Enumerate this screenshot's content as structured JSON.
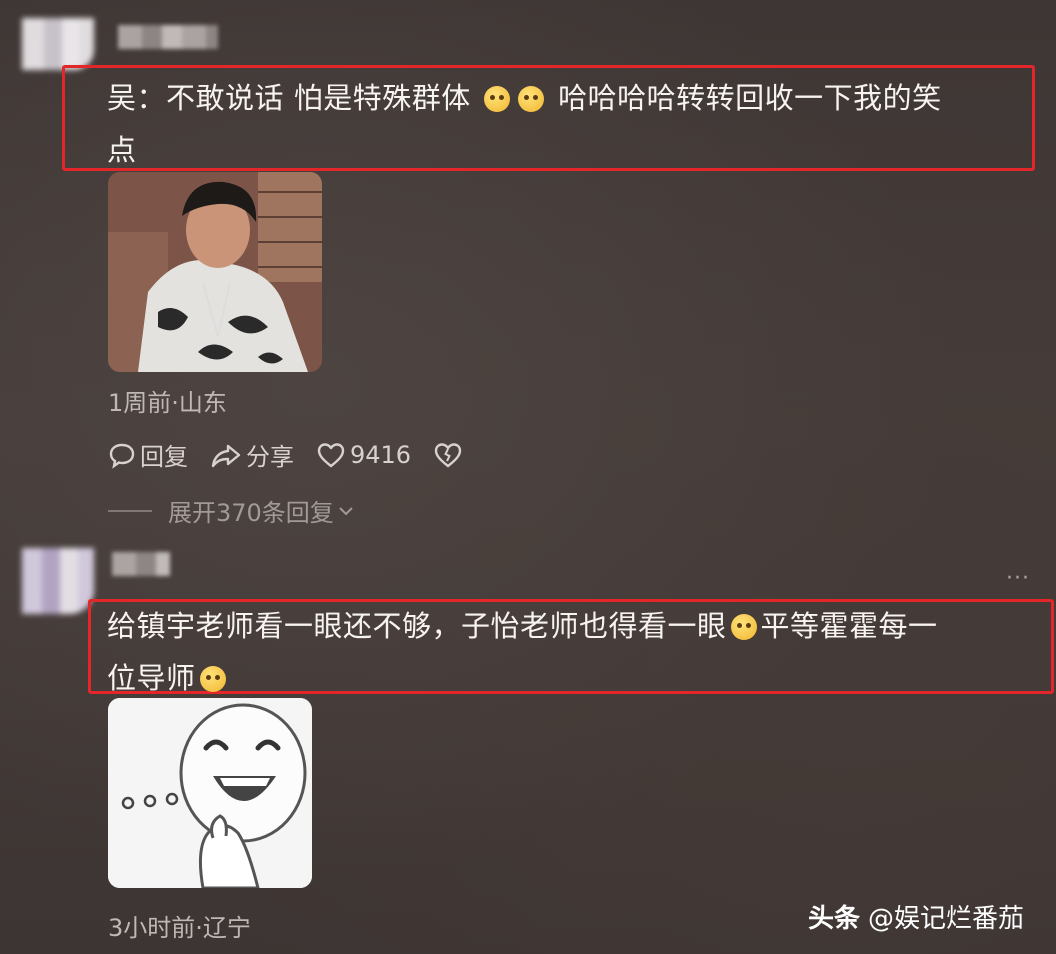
{
  "comments": [
    {
      "text_line1": "吴：不敢说话 怕是特殊群体",
      "text_line1_tail": "哈哈哈哈转转回收一下我的笑",
      "text_line2": "点",
      "meta": "1周前·山东",
      "reply_label": "回复",
      "share_label": "分享",
      "likes": "9416",
      "expand_label": "展开370条回复",
      "image_icon": "man-in-camo-jacket-photo"
    },
    {
      "text_line1": "给镇宇老师看一眼还不够，子怡老师也得看一眼",
      "text_line1_tail": "平等霍霍每一",
      "text_line2": "位导师",
      "meta": "3小时前·辽宁",
      "more_icon": "···",
      "image_icon": "laughing-face-sticker"
    }
  ],
  "watermark": {
    "brand": "头条",
    "handle": "@娱记烂番茄"
  },
  "colors": {
    "highlight_border": "#e2262a",
    "text_primary": "#f7f3f1",
    "text_meta": "#bfb8b5"
  }
}
